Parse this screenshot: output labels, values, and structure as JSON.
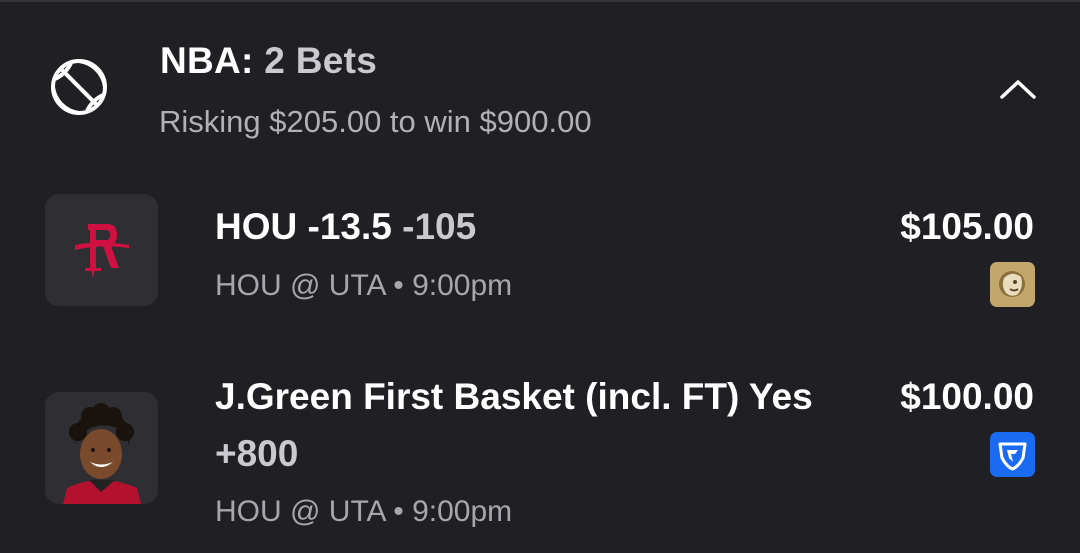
{
  "group": {
    "league": "NBA:",
    "count_label": "2 Bets",
    "summary": "Risking $205.00 to win $900.00",
    "sport_icon": "basketball-icon",
    "toggle_icon": "chevron-up-icon"
  },
  "bets": [
    {
      "selection": "HOU -13.5",
      "odds": "-105",
      "matchup": "HOU @ UTA • 9:00pm",
      "stake": "$105.00",
      "thumbnail": "houston-rockets-logo",
      "book_icon": "betmgm-lion-icon",
      "book_color": "#c2a76c",
      "accent_color": "#ce1141"
    },
    {
      "selection": "J.Green First Basket (incl. FT) Yes",
      "odds": "+800",
      "matchup": "HOU @ UTA • 9:00pm",
      "stake": "$100.00",
      "thumbnail": "player-headshot",
      "book_icon": "fanduel-shield-icon",
      "book_color": "#1a6bf2"
    }
  ],
  "colors": {
    "background": "#202024",
    "text_primary": "#ffffff",
    "text_secondary": "#a6a6ad"
  }
}
